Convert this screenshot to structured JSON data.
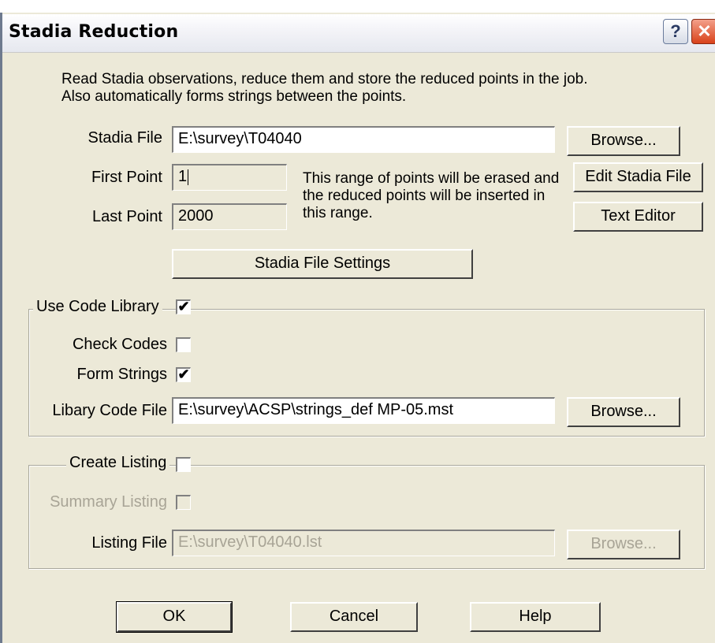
{
  "window": {
    "title": "Stadia Reduction",
    "help_glyph": "?",
    "close_glyph": "✕"
  },
  "description": "Read Stadia observations, reduce them and store the reduced points in the job. Also automatically forms strings between the points.",
  "stadia_file": {
    "label": "Stadia File",
    "value": "E:\\survey\\T04040",
    "browse_label": "Browse..."
  },
  "first_point": {
    "label": "First Point",
    "value": "1"
  },
  "last_point": {
    "label": "Last Point",
    "value": "2000"
  },
  "range_note": "This range of points will be erased and the reduced points will be inserted in this range.",
  "buttons": {
    "edit_stadia": "Edit Stadia File",
    "text_editor": "Text Editor",
    "settings": "Stadia File Settings",
    "ok": "OK",
    "cancel": "Cancel",
    "help": "Help"
  },
  "code_library": {
    "legend": "Use Code Library",
    "checked": true,
    "check_codes": {
      "label": "Check Codes",
      "checked": false
    },
    "form_strings": {
      "label": "Form Strings",
      "checked": true
    },
    "library_file": {
      "label": "Libary Code File",
      "value": "E:\\survey\\ACSP\\strings_def MP-05.mst",
      "browse_label": "Browse..."
    }
  },
  "listing": {
    "legend": "Create Listing",
    "checked": false,
    "summary": {
      "label": "Summary Listing",
      "checked": false
    },
    "listing_file": {
      "label": "Listing File",
      "value": "E:\\survey\\T04040.lst",
      "browse_label": "Browse..."
    }
  },
  "colors": {
    "dialog_bg": "#ece9d8",
    "disabled_text": "#a8a496",
    "close_red": "#d9421a"
  }
}
